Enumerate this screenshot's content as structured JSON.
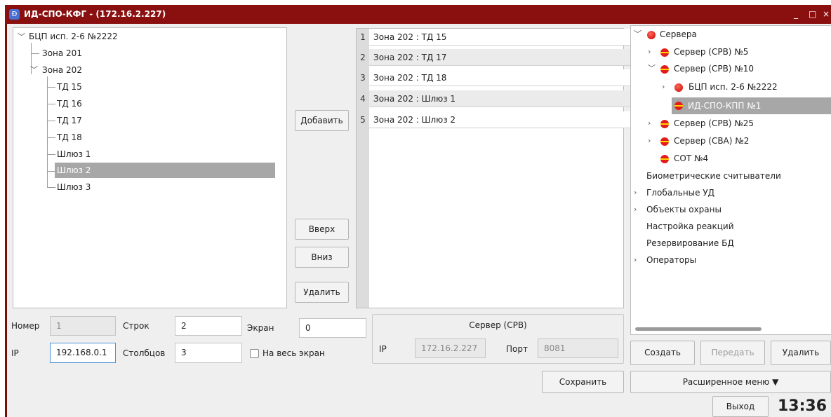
{
  "window": {
    "title": "ИД-СПО-КФГ -  (172.16.2.227)",
    "logo_glyph": "Ð",
    "controls": [
      "_",
      "□",
      "×"
    ]
  },
  "left_tree": {
    "root": "БЦП исп. 2-6 №2222",
    "zone201": "Зона 201",
    "zone202": "Зона 202",
    "children": [
      "ТД 15",
      "ТД 16",
      "ТД 17",
      "ТД 18",
      "Шлюз 1",
      "Шлюз 2",
      "Шлюз 3"
    ],
    "selected": "Шлюз 2"
  },
  "middle_buttons": {
    "add": "Добавить",
    "up": "Вверх",
    "down": "Вниз",
    "delete": "Удалить"
  },
  "list": {
    "rows": [
      {
        "num": "1",
        "text": "Зона 202 : ТД 15"
      },
      {
        "num": "2",
        "text": "Зона 202 : ТД 17"
      },
      {
        "num": "3",
        "text": "Зона 202 : ТД 18"
      },
      {
        "num": "4",
        "text": "Зона 202 : Шлюз 1"
      },
      {
        "num": "5",
        "text": "Зона 202 : Шлюз 2"
      }
    ]
  },
  "right_tree": {
    "servers": "Сервера",
    "srv5": "Сервер (СРВ) №5",
    "srv10": "Сервер (СРВ) №10",
    "bcp": "БЦП исп. 2-6 №2222",
    "kpp": "ИД-СПО-КПП №1",
    "srv25": "Сервер (СРВ) №25",
    "sva2": "Сервер (СВА) №2",
    "sot4": "СОТ №4",
    "bio": "Биометрические считыватели",
    "global": "Глобальные УД",
    "objects": "Объекты охраны",
    "reactions": "Настройка реакций",
    "backup": "Резервирование БД",
    "operators": "Операторы"
  },
  "form": {
    "number_label": "Номер",
    "number_value": "1",
    "rows_label": "Строк",
    "rows_value": "2",
    "screen_label": "Экран",
    "screen_value": "0",
    "ip_label": "IP",
    "ip_value": "192.168.0.1",
    "cols_label": "Столбцов",
    "cols_value": "3",
    "fullscreen_label": "На весь экран"
  },
  "server_box": {
    "title": "Сервер (СРВ)",
    "ip_label": "IP",
    "ip_value": "172.16.2.227",
    "port_label": "Порт",
    "port_value": "8081"
  },
  "right_buttons": {
    "create": "Создать",
    "transfer": "Передать",
    "delete": "Удалить",
    "extended": "Расширенное меню ▼",
    "exit": "Выход"
  },
  "save_button": "Сохранить",
  "clock": "13:36"
}
